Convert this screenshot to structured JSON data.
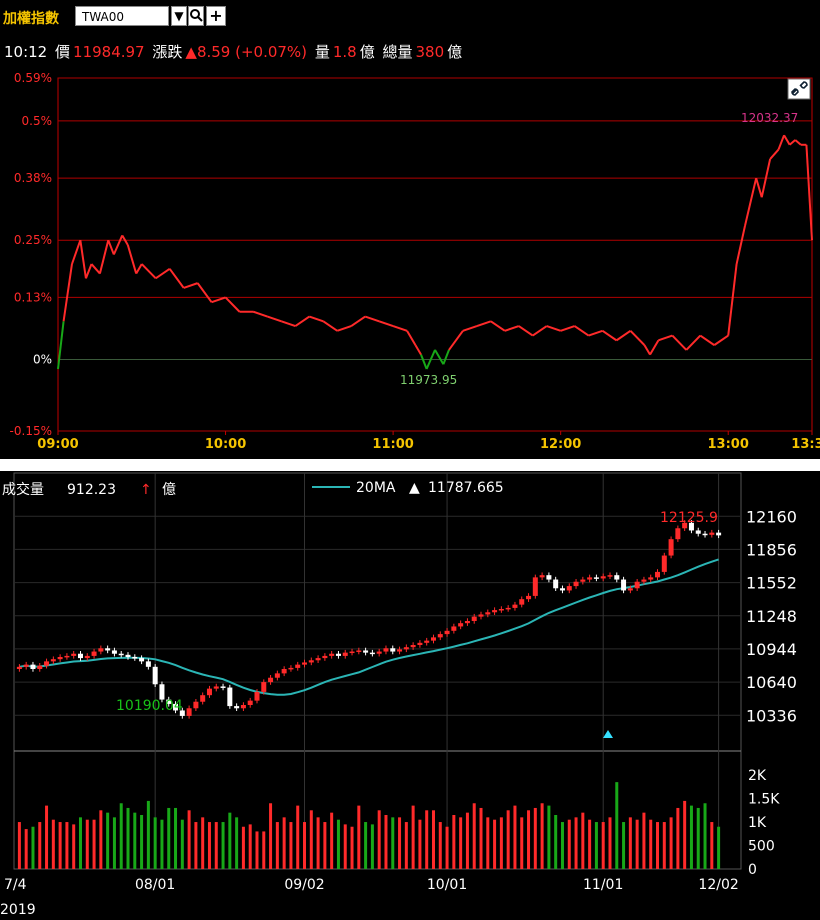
{
  "header": {
    "title": "加權指數",
    "symbol": "TWA00",
    "time": "10:12",
    "price_label": "價",
    "price": "11984.97",
    "change_label": "漲跌",
    "change": "▲8.59 (+0.07%)",
    "volume_label": "量",
    "volume": "1.8",
    "volume_unit": "億",
    "total_label": "總量",
    "total": "380",
    "total_unit": "億"
  },
  "colors": {
    "up": "#ff2a2a",
    "down": "#18a818",
    "ma": "#2bb5b5",
    "grid": "#b00000",
    "bg": "#000000"
  },
  "chart_data": [
    {
      "type": "line",
      "title": "",
      "ylabels": [
        "0.59%",
        "0.5%",
        "0.38%",
        "0.25%",
        "0.13%",
        "0%",
        "-0.15%"
      ],
      "yvalues": [
        0.59,
        0.5,
        0.38,
        0.25,
        0.13,
        0,
        -0.15
      ],
      "ylim": [
        -0.15,
        0.59
      ],
      "xlabels": [
        "09:00",
        "10:00",
        "11:00",
        "12:00",
        "13:00",
        "13:30"
      ],
      "xlim": [
        "09:00",
        "13:30"
      ],
      "annotations": {
        "high": "12032.37",
        "low": "11973.95"
      },
      "series": [
        {
          "x": [
            "09:00",
            "09:02",
            "09:05",
            "09:08",
            "09:10",
            "09:12",
            "09:15",
            "09:18",
            "09:20",
            "09:23",
            "09:25",
            "09:28",
            "09:30",
            "09:35",
            "09:40",
            "09:45",
            "09:50",
            "09:55",
            "10:00",
            "10:05",
            "10:10",
            "10:15",
            "10:20",
            "10:25",
            "10:30",
            "10:35",
            "10:40",
            "10:45",
            "10:50",
            "10:55",
            "11:00",
            "11:05",
            "11:08",
            "11:10",
            "11:12",
            "11:15",
            "11:18",
            "11:20",
            "11:25",
            "11:30",
            "11:35",
            "11:40",
            "11:45",
            "11:50",
            "11:55",
            "12:00",
            "12:05",
            "12:10",
            "12:15",
            "12:20",
            "12:25",
            "12:30",
            "12:32",
            "12:35",
            "12:40",
            "12:45",
            "12:50",
            "12:55",
            "13:00",
            "13:03",
            "13:06",
            "13:10",
            "13:12",
            "13:15",
            "13:18",
            "13:20",
            "13:22",
            "13:24",
            "13:26",
            "13:28",
            "13:30"
          ],
          "values": [
            -0.02,
            0.08,
            0.2,
            0.25,
            0.17,
            0.2,
            0.18,
            0.25,
            0.22,
            0.26,
            0.24,
            0.18,
            0.2,
            0.17,
            0.19,
            0.15,
            0.16,
            0.12,
            0.13,
            0.1,
            0.1,
            0.09,
            0.08,
            0.07,
            0.09,
            0.08,
            0.06,
            0.07,
            0.09,
            0.08,
            0.07,
            0.06,
            0.03,
            0.01,
            -0.02,
            0.02,
            -0.01,
            0.02,
            0.06,
            0.07,
            0.08,
            0.06,
            0.07,
            0.05,
            0.07,
            0.06,
            0.07,
            0.05,
            0.06,
            0.04,
            0.06,
            0.03,
            0.01,
            0.04,
            0.05,
            0.02,
            0.05,
            0.03,
            0.05,
            0.2,
            0.28,
            0.38,
            0.34,
            0.42,
            0.44,
            0.47,
            0.45,
            0.46,
            0.45,
            0.45,
            0.25
          ]
        }
      ]
    },
    {
      "type": "candlestick",
      "title": "",
      "volume_title": "成交量",
      "volume_value": "912.23",
      "volume_arrow": "↑",
      "volume_unit": "億",
      "ma_label": "20MA",
      "ma_arrow": "▲",
      "ma_value": "11787.665",
      "high_label": "12125.9",
      "low_label": "10190.04",
      "ylabels": [
        "12160",
        "11856",
        "11552",
        "11248",
        "10944",
        "10640",
        "10336"
      ],
      "yvalues": [
        12160,
        11856,
        11552,
        11248,
        10944,
        10640,
        10336
      ],
      "ylim": [
        10100,
        12300
      ],
      "vol_ylabels": [
        "2K",
        "1.5K",
        "1K",
        "500",
        "0"
      ],
      "vol_yvalues": [
        2000,
        1500,
        1000,
        500,
        0
      ],
      "vol_ylim": [
        0,
        2300
      ],
      "xlabels": [
        "7/4",
        "08/01",
        "09/02",
        "10/01",
        "11/01",
        "12/02"
      ],
      "year": "2019",
      "close": [
        10780,
        10800,
        10760,
        10790,
        10830,
        10850,
        10870,
        10880,
        10900,
        10860,
        10880,
        10920,
        10950,
        10930,
        10900,
        10890,
        10870,
        10860,
        10830,
        10780,
        10620,
        10480,
        10440,
        10380,
        10330,
        10400,
        10460,
        10520,
        10580,
        10600,
        10590,
        10420,
        10400,
        10430,
        10470,
        10550,
        10640,
        10680,
        10720,
        10760,
        10770,
        10800,
        10820,
        10840,
        10860,
        10880,
        10900,
        10880,
        10910,
        10920,
        10930,
        10910,
        10900,
        10920,
        10950,
        10920,
        10940,
        10960,
        10980,
        11000,
        11020,
        11050,
        11080,
        11110,
        11150,
        11180,
        11200,
        11240,
        11260,
        11280,
        11300,
        11310,
        11320,
        11350,
        11400,
        11430,
        11600,
        11620,
        11580,
        11500,
        11480,
        11520,
        11560,
        11580,
        11600,
        11590,
        11610,
        11620,
        11580,
        11480,
        11500,
        11560,
        11580,
        11600,
        11650,
        11800,
        11950,
        12050,
        12100,
        12030,
        12000,
        11990,
        12010,
        11985
      ],
      "volume": [
        1000,
        850,
        900,
        1000,
        1350,
        1050,
        1000,
        1000,
        950,
        1100,
        1050,
        1050,
        1250,
        1200,
        1100,
        1400,
        1300,
        1200,
        1150,
        1450,
        1100,
        1050,
        1300,
        1300,
        1050,
        1250,
        1000,
        1100,
        1000,
        1000,
        1000,
        1200,
        1100,
        900,
        950,
        800,
        800,
        1400,
        1000,
        1100,
        1000,
        1350,
        1000,
        1250,
        1100,
        1000,
        1200,
        1050,
        950,
        900,
        1350,
        1000,
        950,
        1250,
        1150,
        1100,
        1100,
        1000,
        1350,
        1050,
        1250,
        1250,
        1000,
        900,
        1150,
        1100,
        1200,
        1400,
        1300,
        1100,
        1050,
        1100,
        1250,
        1350,
        1100,
        1250,
        1300,
        1400,
        1350,
        1150,
        1000,
        1050,
        1100,
        1200,
        1050,
        1000,
        1000,
        1100,
        1850,
        1000,
        1100,
        1050,
        1200,
        1050,
        1000,
        1000,
        1100,
        1300,
        1450,
        1350,
        1300,
        1400,
        1000,
        900
      ]
    }
  ]
}
